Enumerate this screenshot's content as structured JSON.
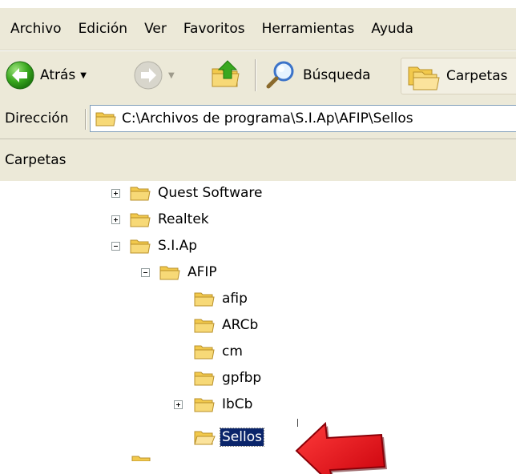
{
  "menu": [
    "Archivo",
    "Edición",
    "Ver",
    "Favoritos",
    "Herramientas",
    "Ayuda"
  ],
  "toolbar": {
    "back_label": "Atrás",
    "search_label": "Búsqueda",
    "folders_label": "Carpetas"
  },
  "address": {
    "label": "Dirección",
    "path": "C:\\Archivos de programa\\S.I.Ap\\AFIP\\Sellos"
  },
  "pane": {
    "title": "Carpetas"
  },
  "tree": {
    "quest": "Quest Software",
    "realtek": "Realtek",
    "siap": "S.I.Ap",
    "afip": "AFIP",
    "afip_sub": "afip",
    "arcb": "ARCb",
    "cm": "cm",
    "gpfbp": "gpfbp",
    "ibcb": "IbCb",
    "sellos": "Sellos"
  },
  "colors": {
    "chrome": "#ece9d8",
    "selection": "#0a246a",
    "folder": "#f2c94c",
    "arrow": "#e8141b"
  },
  "icons": {
    "back": "green-back-arrow-icon",
    "forward": "gray-forward-arrow-icon",
    "up": "folder-up-icon",
    "search": "magnifier-icon",
    "folders": "folders-icon",
    "folder": "folder-icon",
    "pointer": "red-arrow-icon"
  }
}
